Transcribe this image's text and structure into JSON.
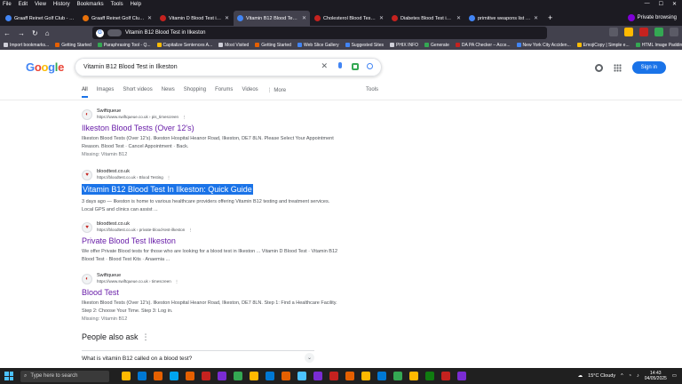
{
  "browser": {
    "menu": [
      "File",
      "Edit",
      "View",
      "History",
      "Bookmarks",
      "Tools",
      "Help"
    ],
    "tabs": [
      {
        "title": "Graaff Reinet Golf Club - Search X",
        "color": "#4285f4",
        "active": false
      },
      {
        "title": "Graaff Reinet Golf Club at Duck",
        "color": "#e8710a",
        "active": false
      },
      {
        "title": "Vitamin D Blood Test in Middle",
        "color": "#c5221f",
        "active": false
      },
      {
        "title": "Vitamin B12 Blood Test in Ilkest",
        "color": "#4285f4",
        "active": true
      },
      {
        "title": "Cholesterol Blood Test in Ampt",
        "color": "#c5221f",
        "active": false
      },
      {
        "title": "Diabetes Blood Test in Portishe",
        "color": "#c5221f",
        "active": false
      },
      {
        "title": "primitive weapons list - Google",
        "color": "#4285f4",
        "active": false
      }
    ],
    "new_tab": "+",
    "private_label": "Private browsing",
    "url": "Vitamin B12 Blood Test in Ilkeston",
    "bookmarks": [
      {
        "label": "Import bookmarks...",
        "color": "#cfcfd8"
      },
      {
        "label": "Getting Started",
        "color": "#e66000"
      },
      {
        "label": "Paraphrasing Tool - Q...",
        "color": "#34a853"
      },
      {
        "label": "Capitalize Sentences A...",
        "color": "#fbbc05"
      },
      {
        "label": "Most Visited",
        "color": "#cfcfd8"
      },
      {
        "label": "Getting Started",
        "color": "#e66000"
      },
      {
        "label": "Web Slice Gallery",
        "color": "#4285f4"
      },
      {
        "label": "Suggested Sites",
        "color": "#4285f4"
      },
      {
        "label": "PHIX INFO",
        "color": "#cfcfd8"
      },
      {
        "label": "Generate",
        "color": "#34a853"
      },
      {
        "label": "DA PA Checker – Acce...",
        "color": "#c5221f"
      },
      {
        "label": "New York City Acciden...",
        "color": "#4285f4"
      },
      {
        "label": "EmojiCopy | Simple e...",
        "color": "#fbbc05"
      },
      {
        "label": "HTML Image Padding ...",
        "color": "#34a853"
      }
    ]
  },
  "google": {
    "logo": "Google",
    "query": "Vitamin B12 Blood Test in Ilkeston",
    "sign_in": "Sign in",
    "tabs": [
      "All",
      "Images",
      "Short videos",
      "News",
      "Shopping",
      "Forums",
      "Videos",
      "⋮ More"
    ],
    "tools": "Tools",
    "results": [
      {
        "site": "Swiftqueue",
        "url": "https://www.swiftqueue.co.uk › pis_timescreen",
        "icon": "◐",
        "title": "Ilkeston Blood Tests (Over 12's)",
        "snippet": "Ilkeston Blood Tests (Over 12's). Ilkeston Hospital Heanor Road, Ilkeston, DE7 8LN. Please Select Your Appointment Reason. Blood Test · Cancel Appointment · Back.",
        "missing": "Missing: Vitamin B12",
        "highlight": false,
        "visited": true
      },
      {
        "site": "bloodtest.co.uk",
        "url": "https://bloodtest.co.uk › Blood Testing",
        "icon": "♥",
        "title": "Vitamin B12 Blood Test In Ilkeston: Quick Guide",
        "snippet": "3 days ago — Ilkeston is home to various healthcare providers offering Vitamin B12 testing and treatment services. Local GPS and clinics can assist ...",
        "missing": "",
        "highlight": true,
        "visited": false
      },
      {
        "site": "bloodtest.co.uk",
        "url": "https://bloodtest.co.uk › private-blood-test-ilkeston",
        "icon": "♥",
        "title": "Private Blood Test Ilkeston",
        "snippet": "We offer Private Blood tests for those who are looking for a blood test in Ilkeston ... Vitamin D Blood Test · Vitamin B12 Blood Test · Blood Test Kits · Anaemia ...",
        "missing": "",
        "highlight": false,
        "visited": true
      },
      {
        "site": "Swiftqueue",
        "url": "https://www.swiftqueue.co.uk › timescreen",
        "icon": "◐",
        "title": "Blood Test",
        "snippet": "Ilkeston Blood Tests (Over 12's). Ilkeston Hospital Heanor Road, Ilkeston, DE7 8LN. Step 1: Find a Healthcare Facility. Step 2: Choose Your Time. Step 3: Log in.",
        "missing": "Missing: Vitamin B12",
        "highlight": false,
        "visited": true
      }
    ],
    "people_also_ask": "People also ask",
    "paa_more": "⋮",
    "paa_question": "What is vitamin B12 called on a blood test?",
    "paa_chevron": "⌄"
  },
  "taskbar": {
    "search_placeholder": "Type here to search",
    "app_colors": [
      "#ffb900",
      "#0078d4",
      "#e66000",
      "#00a4ef",
      "#e66000",
      "#c5221f",
      "#7a2cd3",
      "#34a853",
      "#ffb900",
      "#0078d4",
      "#e66000",
      "#4cc2ff",
      "#7a2cd3",
      "#c5221f",
      "#e66000",
      "#ffb900",
      "#0078d4",
      "#34a853",
      "#ffb900",
      "#107c10",
      "#c5221f",
      "#7a2cd3"
    ],
    "weather": "15°C  Cloudy",
    "time": "14:43",
    "date": "04/05/2025"
  }
}
